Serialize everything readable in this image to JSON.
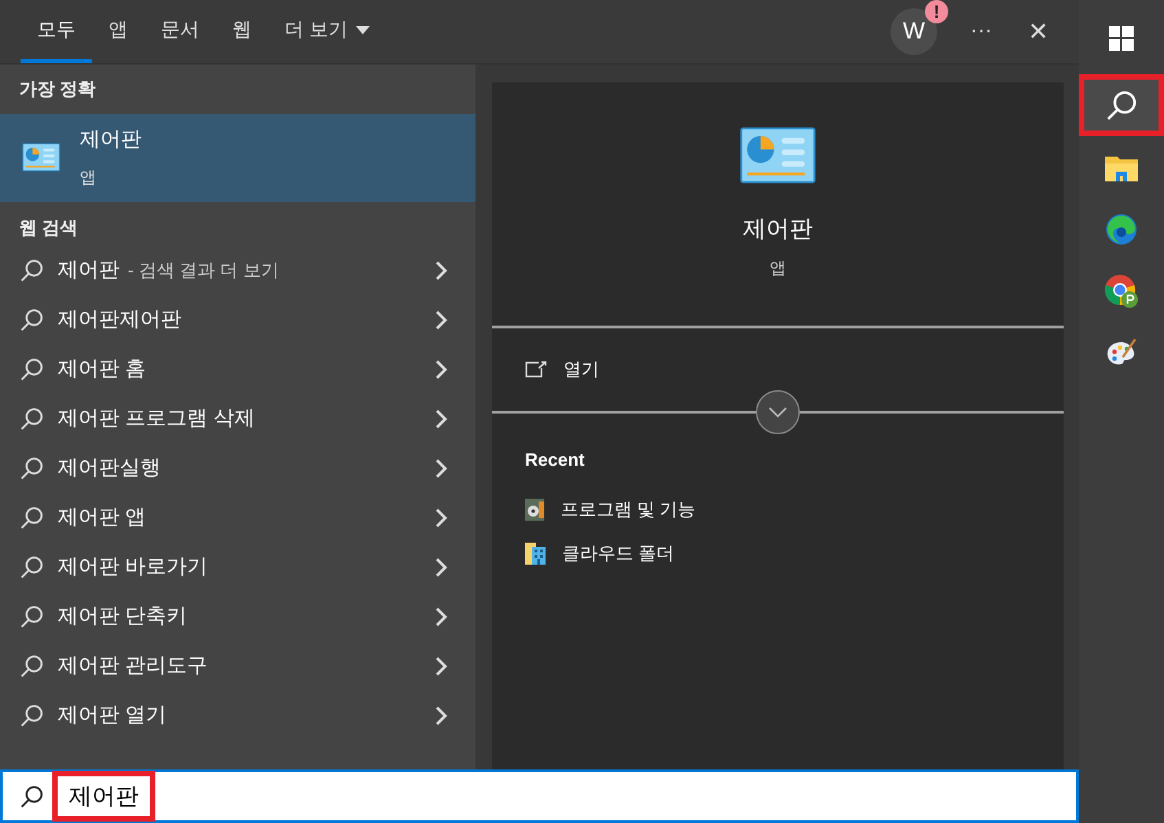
{
  "tabs": [
    {
      "label": "모두",
      "selected": true
    },
    {
      "label": "앱",
      "selected": false
    },
    {
      "label": "문서",
      "selected": false
    },
    {
      "label": "웹",
      "selected": false
    },
    {
      "label": "더 보기",
      "selected": false,
      "kind": "dropdown"
    }
  ],
  "account": {
    "initial": "W",
    "badge": "!"
  },
  "more_button": "···",
  "close_button": "✕",
  "best_match": {
    "heading": "가장 정확",
    "name": "제어판",
    "type": "앱",
    "selected": true
  },
  "web_search": {
    "heading": "웹 검색",
    "items": [
      {
        "kind": "query",
        "text": "제어판",
        "suffix": "- 검색 결과 더 보기"
      },
      {
        "kind": "plain",
        "text": "제어판제어판"
      },
      {
        "kind": "plain",
        "text": "제어판 홈"
      },
      {
        "kind": "plain",
        "text": "제어판 프로그램 삭제"
      },
      {
        "kind": "plain",
        "text": "제어판실행"
      },
      {
        "kind": "plain",
        "text": "제어판 앱"
      },
      {
        "kind": "plain",
        "text": "제어판 바로가기"
      },
      {
        "kind": "plain",
        "text": "제어판 단축키"
      },
      {
        "kind": "plain",
        "text": "제어판 관리도구"
      },
      {
        "kind": "plain",
        "text": "제어판 열기"
      }
    ]
  },
  "detail": {
    "name": "제어판",
    "type": "앱",
    "actions": [
      {
        "label": "열기"
      }
    ],
    "recent_heading": "Recent",
    "recent": [
      {
        "kind": "programs",
        "label": "프로그램 및 기능"
      },
      {
        "kind": "cloud-folder",
        "label": "클라우드 폴더"
      }
    ]
  },
  "search_field": {
    "value": "제어판",
    "highlighted": true
  },
  "taskbar": [
    {
      "kind": "start",
      "highlighted": false
    },
    {
      "kind": "search",
      "highlighted": true
    },
    {
      "kind": "folder",
      "highlighted": false
    },
    {
      "kind": "edge",
      "highlighted": false
    },
    {
      "kind": "chrome",
      "highlighted": false
    },
    {
      "kind": "paint",
      "highlighted": false
    }
  ]
}
